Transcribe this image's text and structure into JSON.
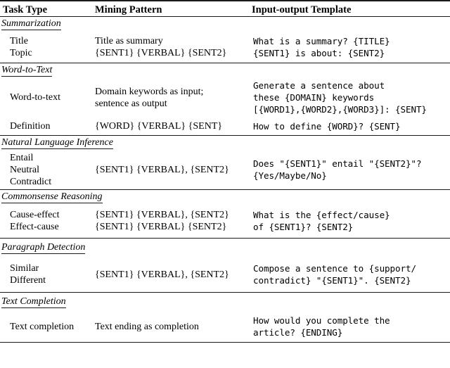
{
  "table": {
    "headers": {
      "task_type": "Task Type",
      "mining_pattern": "Mining Pattern",
      "input_output_template": "Input-output Template"
    },
    "sections": [
      {
        "heading": "Summarization",
        "rows": [
          {
            "task_types": [
              "Title",
              "Topic"
            ],
            "mining_pattern": [
              "Title as summary",
              "{SENT1} {VERBAL} {SENT2}"
            ],
            "template": [
              "What is a summary? {TITLE}",
              "{SENT1} is about: {SENT2}"
            ]
          }
        ]
      },
      {
        "heading": "Word-to-Text",
        "rows": [
          {
            "task_types": [
              "Word-to-text"
            ],
            "mining_pattern": [
              "Domain keywords as input;",
              "sentence as output"
            ],
            "template": [
              "Generate a sentence about",
              "these {DOMAIN} keywords",
              "[{WORD1},{WORD2},{WORD3}]: {SENT}"
            ]
          },
          {
            "task_types": [
              "Definition"
            ],
            "mining_pattern": [
              "{WORD} {VERBAL} {SENT}"
            ],
            "template": [
              "How to define {WORD}? {SENT}"
            ]
          }
        ]
      },
      {
        "heading": "Natural Language Inference",
        "rows": [
          {
            "task_types": [
              "Entail",
              "Neutral",
              "Contradict"
            ],
            "mining_pattern": [
              "{SENT1} {VERBAL}, {SENT2}"
            ],
            "template": [
              "Does \"{SENT1}\" entail \"{SENT2}\"?",
              "{Yes/Maybe/No}"
            ]
          }
        ]
      },
      {
        "heading": "Commonsense Reasoning",
        "rows": [
          {
            "task_types": [
              "Cause-effect",
              "Effect-cause"
            ],
            "mining_pattern": [
              "{SENT1} {VERBAL}, {SENT2}",
              "{SENT1} {VERBAL} {SENT2}"
            ],
            "template": [
              "What is the {effect/cause}",
              "of {SENT1}? {SENT2}"
            ]
          }
        ]
      },
      {
        "heading": "Paragraph Detection",
        "rows": [
          {
            "task_types": [
              "Similar",
              "Different"
            ],
            "mining_pattern": [
              "{SENT1} {VERBAL}, {SENT2}"
            ],
            "template": [
              "Compose a sentence to {support/",
              "contradict} \"{SENT1}\". {SENT2}"
            ]
          }
        ]
      },
      {
        "heading": "Text Completion",
        "rows": [
          {
            "task_types": [
              "Text completion"
            ],
            "mining_pattern": [
              "Text ending as completion"
            ],
            "template": [
              "How would you complete the",
              "article? {ENDING}"
            ]
          }
        ]
      }
    ]
  }
}
